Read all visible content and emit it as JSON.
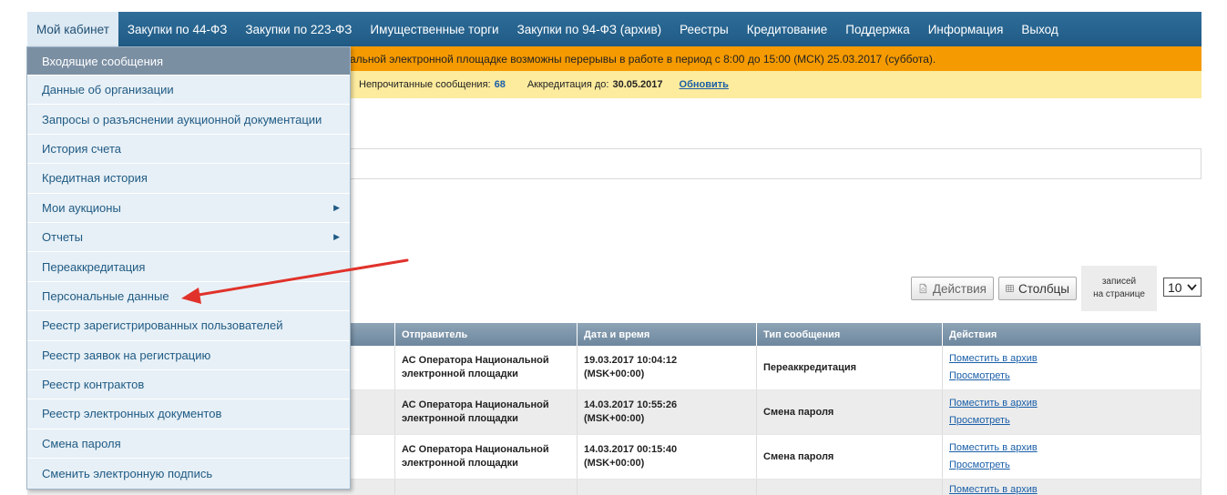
{
  "nav": {
    "items": [
      "Мой кабинет",
      "Закупки по 44-ФЗ",
      "Закупки по 223-ФЗ",
      "Имущественные торги",
      "Закупки по 94-ФЗ (архив)",
      "Реестры",
      "Кредитование",
      "Поддержка",
      "Информация",
      "Выход"
    ]
  },
  "notice": {
    "text": "альной электронной площадке возможны перерывы в работе в период с 8:00 до 15:00 (МСК) 25.03.2017 (суббота)."
  },
  "info": {
    "unread_label": "Непрочитанные сообщения:",
    "unread_count": "68",
    "accred_label": "Аккредитация до:",
    "accred_date": "30.05.2017",
    "refresh": "Обновить"
  },
  "controls": {
    "actions": "Действия",
    "columns": "Столбцы",
    "records_line1": "записей",
    "records_line2": "на странице",
    "per_page": "10"
  },
  "table": {
    "headers": [
      "",
      "Отправитель",
      "Дата и время",
      "Тип сообщения",
      "Действия"
    ],
    "rows": [
      {
        "sender1": "АС Оператора Национальной",
        "sender2": "электронной площадки",
        "date1": "19.03.2017 10:04:12",
        "date2": "(MSK+00:00)",
        "type": "Переаккредитация",
        "act1": "Поместить в архив",
        "act2": "Просмотреть"
      },
      {
        "sender1": "АС Оператора Национальной",
        "sender2": "электронной площадки",
        "date1": "14.03.2017 10:55:26",
        "date2": "(MSK+00:00)",
        "type": "Смена пароля",
        "act1": "Поместить в архив",
        "act2": "Просмотреть"
      },
      {
        "sender1": "АС Оператора Национальной",
        "sender2": "электронной площадки",
        "date1": "14.03.2017 00:15:40",
        "date2": "(MSK+00:00)",
        "type": "Смена пароля",
        "act1": "Поместить в архив",
        "act2": "Просмотреть"
      }
    ],
    "partial_act": "Поместить в архив"
  },
  "menu": {
    "items": [
      {
        "label": "Входящие сообщения",
        "sub": false
      },
      {
        "label": "Данные об организации",
        "sub": false
      },
      {
        "label": "Запросы о разъяснении аукционной документации",
        "sub": false
      },
      {
        "label": "История счета",
        "sub": false
      },
      {
        "label": "Кредитная история",
        "sub": false
      },
      {
        "label": "Мои аукционы",
        "sub": true
      },
      {
        "label": "Отчеты",
        "sub": true
      },
      {
        "label": "Переаккредитация",
        "sub": false
      },
      {
        "label": "Персональные данные",
        "sub": false
      },
      {
        "label": "Реестр зарегистрированных пользователей",
        "sub": false
      },
      {
        "label": "Реестр заявок на регистрацию",
        "sub": false
      },
      {
        "label": "Реестр контрактов",
        "sub": false
      },
      {
        "label": "Реестр электронных документов",
        "sub": false
      },
      {
        "label": "Смена пароля",
        "sub": false
      },
      {
        "label": "Сменить электронную подпись",
        "sub": false
      }
    ]
  },
  "colors": {
    "nav": "#1f5a84",
    "notice": "#f59a00",
    "infobar": "#fdeb9e",
    "arrow": "#e0322b"
  }
}
